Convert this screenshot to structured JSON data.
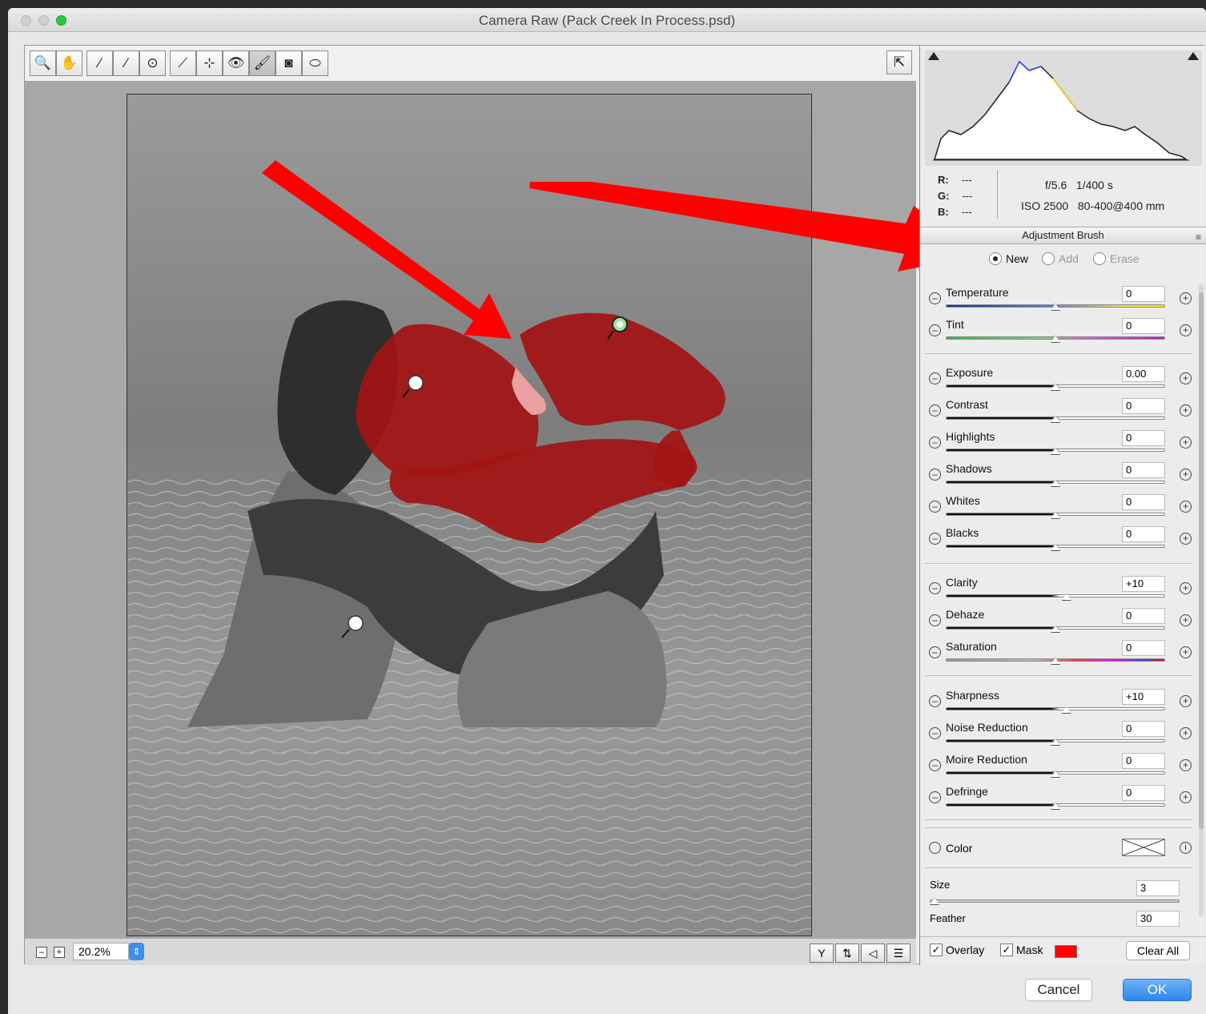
{
  "window": {
    "title": "Camera Raw (Pack Creek In Process.psd)"
  },
  "toolbar": {
    "tools": [
      {
        "name": "zoom-tool",
        "icon": "🔍"
      },
      {
        "name": "hand-tool",
        "icon": "✋"
      },
      {
        "name": "white-balance-tool",
        "icon": "⁄"
      },
      {
        "name": "color-sampler-tool",
        "icon": "⁄"
      },
      {
        "name": "targeted-adjustment-tool",
        "icon": "⊙"
      },
      {
        "name": "straighten-tool",
        "icon": "⟋"
      },
      {
        "name": "spot-removal-tool",
        "icon": "⊹"
      },
      {
        "name": "red-eye-tool",
        "icon": "👁"
      },
      {
        "name": "adjustment-brush-tool",
        "icon": "🖌"
      },
      {
        "name": "graduated-filter-tool",
        "icon": "◙"
      },
      {
        "name": "radial-filter-tool",
        "icon": "⬭"
      }
    ]
  },
  "preview": {
    "zoom_value": "20.2%",
    "zoom_minus": "–",
    "zoom_plus": "+"
  },
  "metadata": {
    "r_label": "R:",
    "g_label": "G:",
    "b_label": "B:",
    "r_val": "---",
    "g_val": "---",
    "b_val": "---",
    "aperture": "f/5.6",
    "shutter": "1/400 s",
    "iso": "ISO 2500",
    "lens": "80-400@400 mm"
  },
  "panel": {
    "title": "Adjustment Brush",
    "modes": [
      {
        "label": "New",
        "selected": true
      },
      {
        "label": "Add",
        "selected": false
      },
      {
        "label": "Erase",
        "selected": false
      }
    ],
    "sliders": [
      {
        "label": "Temperature",
        "value": "0",
        "level": 0.5
      },
      {
        "label": "Tint",
        "value": "0",
        "level": 0.5
      },
      {
        "label": "Exposure",
        "value": "0.00",
        "level": 0.5
      },
      {
        "label": "Contrast",
        "value": "0",
        "level": 0.5
      },
      {
        "label": "Highlights",
        "value": "0",
        "level": 0.5
      },
      {
        "label": "Shadows",
        "value": "0",
        "level": 0.5
      },
      {
        "label": "Whites",
        "value": "0",
        "level": 0.5
      },
      {
        "label": "Blacks",
        "value": "0",
        "level": 0.5
      },
      {
        "label": "Clarity",
        "value": "+10",
        "level": 0.55
      },
      {
        "label": "Dehaze",
        "value": "0",
        "level": 0.5
      },
      {
        "label": "Saturation",
        "value": "0",
        "level": 0.5
      },
      {
        "label": "Sharpness",
        "value": "+10",
        "level": 0.55
      },
      {
        "label": "Noise Reduction",
        "value": "0",
        "level": 0.5
      },
      {
        "label": "Moire Reduction",
        "value": "0",
        "level": 0.5
      },
      {
        "label": "Defringe",
        "value": "0",
        "level": 0.5
      }
    ],
    "color_label": "Color",
    "size_label": "Size",
    "size_value": "3",
    "feather_label": "Feather",
    "feather_value": "30",
    "overlay_label": "Overlay",
    "mask_label": "Mask",
    "mask_color": "#ff0000",
    "clear_all_label": "Clear All"
  },
  "dialog": {
    "cancel_label": "Cancel",
    "ok_label": "OK"
  },
  "colors": {
    "accent": "#3d8ee8",
    "mask_overlay": "#b30000",
    "annotation_arrow": "#ff0000"
  }
}
